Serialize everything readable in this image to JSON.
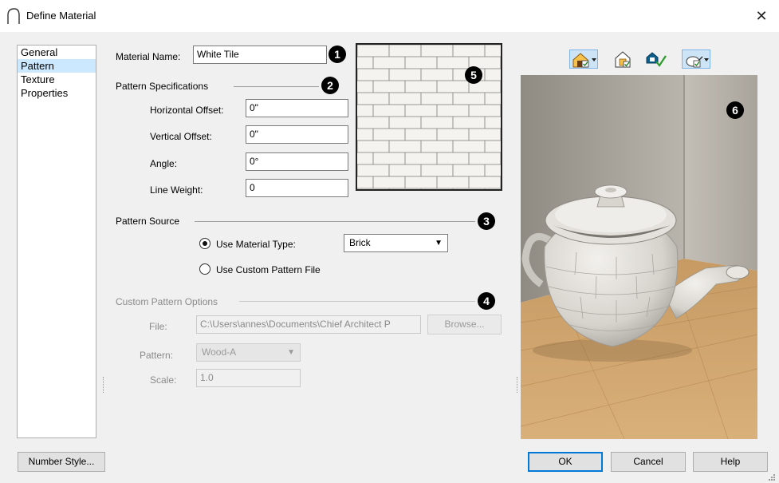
{
  "window": {
    "title": "Define Material",
    "close_glyph": "✕"
  },
  "nav": {
    "items": [
      "General",
      "Pattern",
      "Texture",
      "Properties"
    ],
    "selected": "Pattern"
  },
  "material_name": {
    "label": "Material Name:",
    "value": "White Tile"
  },
  "pattern_specs": {
    "heading": "Pattern Specifications",
    "horizontal_offset": {
      "label": "Horizontal Offset:",
      "value": "0\""
    },
    "vertical_offset": {
      "label": "Vertical Offset:",
      "value": "0\""
    },
    "angle": {
      "label": "Angle:",
      "value": "0°"
    },
    "line_weight": {
      "label": "Line Weight:",
      "value": "0"
    }
  },
  "pattern_source": {
    "heading": "Pattern Source",
    "use_material_type": {
      "label": "Use Material Type:",
      "checked": true
    },
    "material_type_select": "Brick",
    "use_custom_file": {
      "label": "Use Custom Pattern File",
      "checked": false
    }
  },
  "custom_options": {
    "heading": "Custom Pattern Options",
    "file": {
      "label": "File:",
      "value": "C:\\Users\\annes\\Documents\\Chief Architect P"
    },
    "browse_label": "Browse...",
    "pattern": {
      "label": "Pattern:",
      "value": "Wood-A"
    },
    "scale": {
      "label": "Scale:",
      "value": "1.0"
    }
  },
  "callouts": [
    "1",
    "2",
    "3",
    "4",
    "5",
    "6"
  ],
  "toolbar": {
    "icons": [
      "render-house-icon",
      "render-settings-icon",
      "materials-check-icon",
      "teapot-model-icon"
    ]
  },
  "buttons": {
    "number_style": "Number Style...",
    "ok": "OK",
    "cancel": "Cancel",
    "help": "Help"
  },
  "colors": {
    "accent": "#0078d7",
    "selected_nav": "#cce8ff",
    "floor_wood": "#c99a5e",
    "wall": "#b3aea5"
  }
}
